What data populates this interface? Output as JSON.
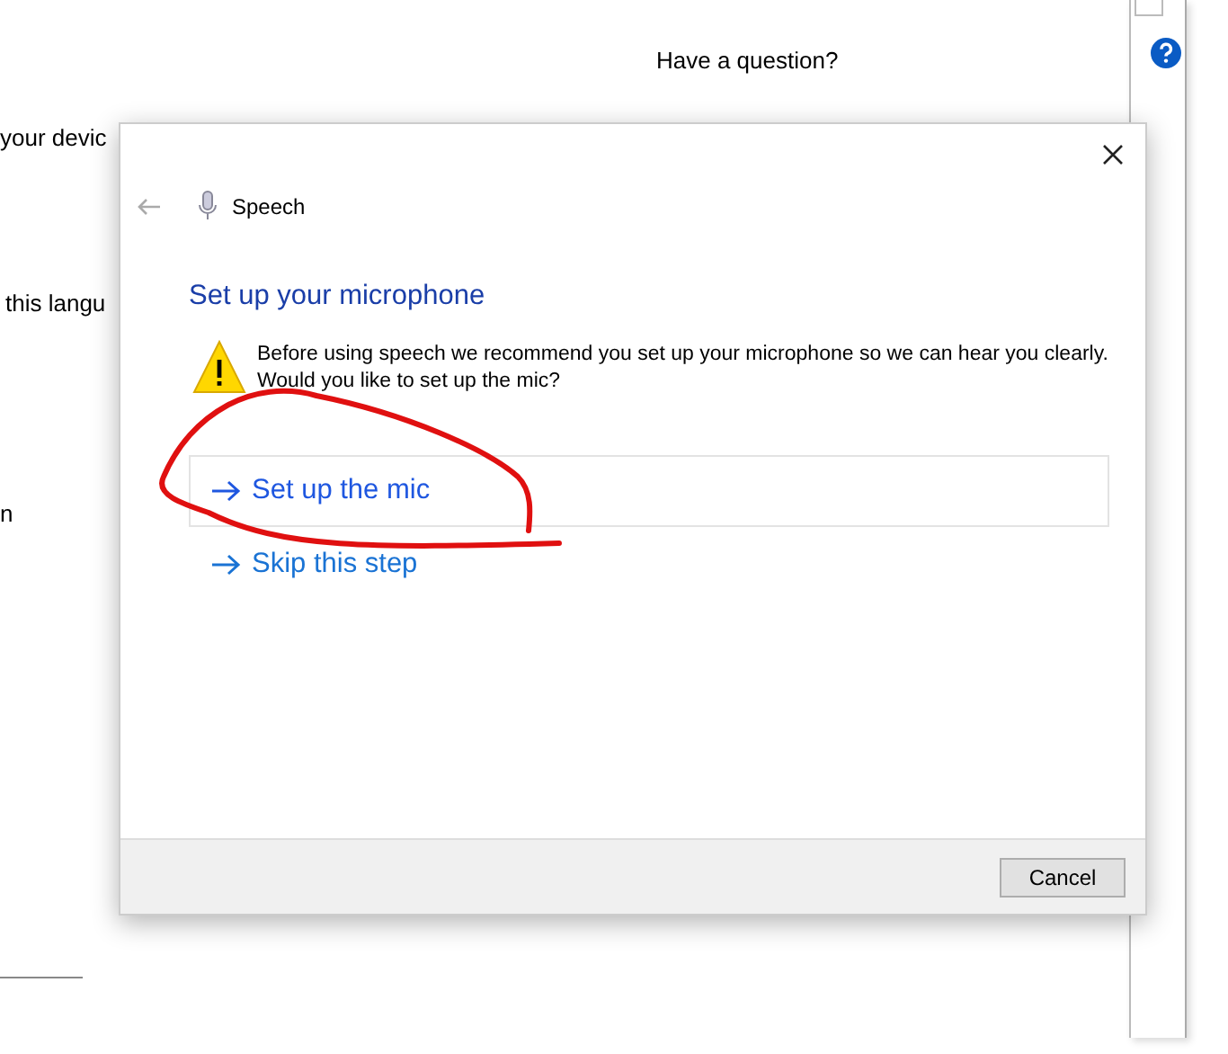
{
  "background_page": {
    "texts": [
      {
        "text": "your devic"
      },
      {
        "text": "this langu"
      },
      {
        "text": "n"
      }
    ],
    "help": {
      "heading": "Have a question?"
    }
  },
  "dialog": {
    "app_label": "Speech",
    "title": "Set up your microphone",
    "message": "Before using speech we recommend you set up your microphone so we can hear you clearly. Would you like to set up the mic?",
    "options": [
      {
        "label": "Set up the mic",
        "selected": true
      },
      {
        "label": "Skip this step",
        "selected": false
      }
    ],
    "buttons": [
      "Cancel"
    ]
  }
}
